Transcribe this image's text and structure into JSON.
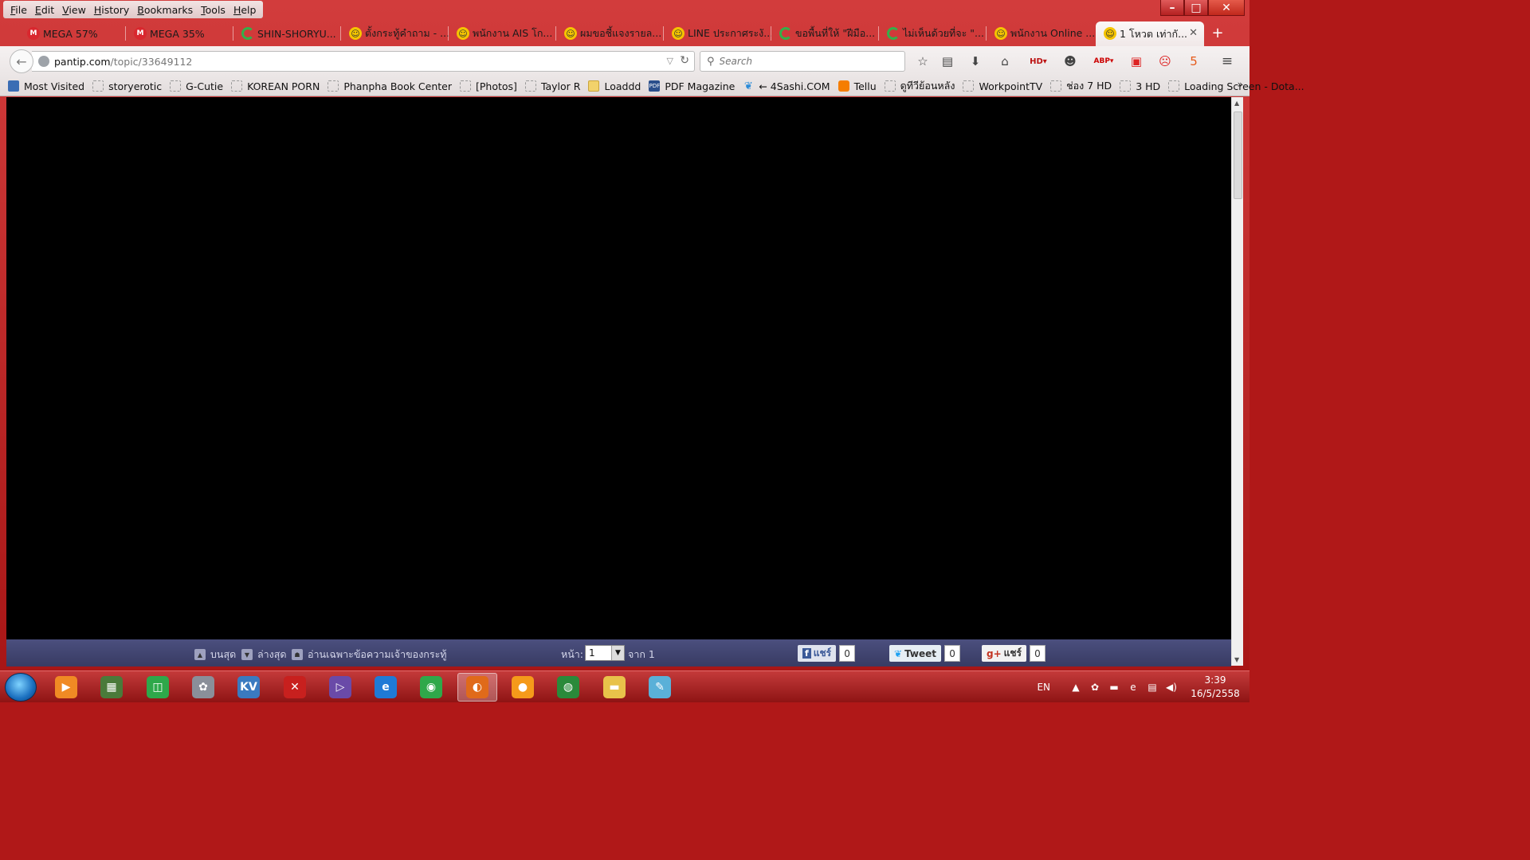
{
  "menubar": [
    "File",
    "Edit",
    "View",
    "History",
    "Bookmarks",
    "Tools",
    "Help"
  ],
  "tabs": [
    {
      "label": "MEGA 57%",
      "icon": "mega-icon"
    },
    {
      "label": "MEGA 35%",
      "icon": "mega-icon"
    },
    {
      "label": "SHIN-SHORYU...",
      "icon": "loading-icon"
    },
    {
      "label": "ตั้งกระทู้คำถาม - ...",
      "icon": "pantip-smiley-icon"
    },
    {
      "label": "พนักงาน AIS โก...",
      "icon": "pantip-smiley-icon"
    },
    {
      "label": "ผมขอชี้แจงรายล...",
      "icon": "pantip-smiley-icon"
    },
    {
      "label": "LINE ประกาศระงั...",
      "icon": "pantip-smiley-icon"
    },
    {
      "label": "ขอพื้นที่ให้ \"ฝีมือ...",
      "icon": "loading-icon"
    },
    {
      "label": "ไม่เห็นด้วยที่จะ \"...",
      "icon": "loading-icon"
    },
    {
      "label": "พนักงาน Online ...",
      "icon": "pantip-smiley-icon"
    },
    {
      "label": "1 โหวต เท่ากั...",
      "icon": "pantip-smiley-icon",
      "active": true
    }
  ],
  "nav": {
    "url_host": "pantip.com",
    "url_path": "/topic/33649112",
    "search_placeholder": "Search"
  },
  "bookmarks": [
    {
      "label": "Most Visited",
      "icon": "most-visited-icon"
    },
    {
      "label": "storyerotic",
      "icon": "page-icon"
    },
    {
      "label": "G-Cutie",
      "icon": "page-icon"
    },
    {
      "label": "KOREAN PORN",
      "icon": "page-icon"
    },
    {
      "label": "Phanpha Book Center",
      "icon": "page-icon"
    },
    {
      "label": "[Photos]",
      "icon": "page-icon"
    },
    {
      "label": "Taylor R",
      "icon": "page-icon"
    },
    {
      "label": "Loaddd",
      "icon": "folder-icon"
    },
    {
      "label": "PDF Magazine",
      "icon": "pdf-icon"
    },
    {
      "label": "← 4Sashi.COM",
      "icon": "leaf-icon"
    },
    {
      "label": "Tellu",
      "icon": "blogger-icon"
    },
    {
      "label": "ดูทีวีย้อนหลัง",
      "icon": "page-icon"
    },
    {
      "label": "WorkpointTV",
      "icon": "page-icon"
    },
    {
      "label": "ช่อง 7 HD",
      "icon": "page-icon"
    },
    {
      "label": "3 HD",
      "icon": "page-icon"
    },
    {
      "label": "Loading Screen - Dota...",
      "icon": "page-icon"
    }
  ],
  "footer": {
    "top": "บนสุด",
    "bottom": "ล่างสุด",
    "owner_only": "อ่านเฉพาะข้อความเจ้าของกระทู้",
    "page_label": "หน้า:",
    "page_value": "1",
    "of_label": "จาก 1",
    "fb_share": "แชร์",
    "fb_count": "0",
    "tweet": "Tweet",
    "tweet_count": "0",
    "gplus_share": "แชร์",
    "gplus_count": "0"
  },
  "tray": {
    "lang": "EN",
    "time": "3:39",
    "date": "16/5/2558"
  },
  "taskbar_apps": [
    {
      "name": "media-player-icon",
      "glyph": "▶",
      "color": "#f08a24"
    },
    {
      "name": "computer-icon",
      "glyph": "▦",
      "color": "#4a7a3a"
    },
    {
      "name": "camtasia-icon",
      "glyph": "◫",
      "color": "#2ea84a"
    },
    {
      "name": "puzzle-icon",
      "glyph": "✿",
      "color": "#8a8f99"
    },
    {
      "name": "kaspersky-icon",
      "glyph": "KV",
      "color": "#3a7ac0"
    },
    {
      "name": "game-icon",
      "glyph": "✕",
      "color": "#c8201e"
    },
    {
      "name": "visual-studio-icon",
      "glyph": "▷",
      "color": "#6a4aa8"
    },
    {
      "name": "internet-explorer-icon",
      "glyph": "e",
      "color": "#1f7ad6"
    },
    {
      "name": "chrome-icon",
      "glyph": "◉",
      "color": "#2fa84a"
    },
    {
      "name": "firefox-icon",
      "glyph": "◐",
      "color": "#e06a1a",
      "active": true
    },
    {
      "name": "orange-app-icon",
      "glyph": "●",
      "color": "#f59a1a"
    },
    {
      "name": "globe-app-icon",
      "glyph": "◍",
      "color": "#2a8a3a"
    },
    {
      "name": "file-explorer-icon",
      "glyph": "▬",
      "color": "#e8c24a"
    },
    {
      "name": "paint-icon",
      "glyph": "✎",
      "color": "#5ab0d8"
    }
  ]
}
